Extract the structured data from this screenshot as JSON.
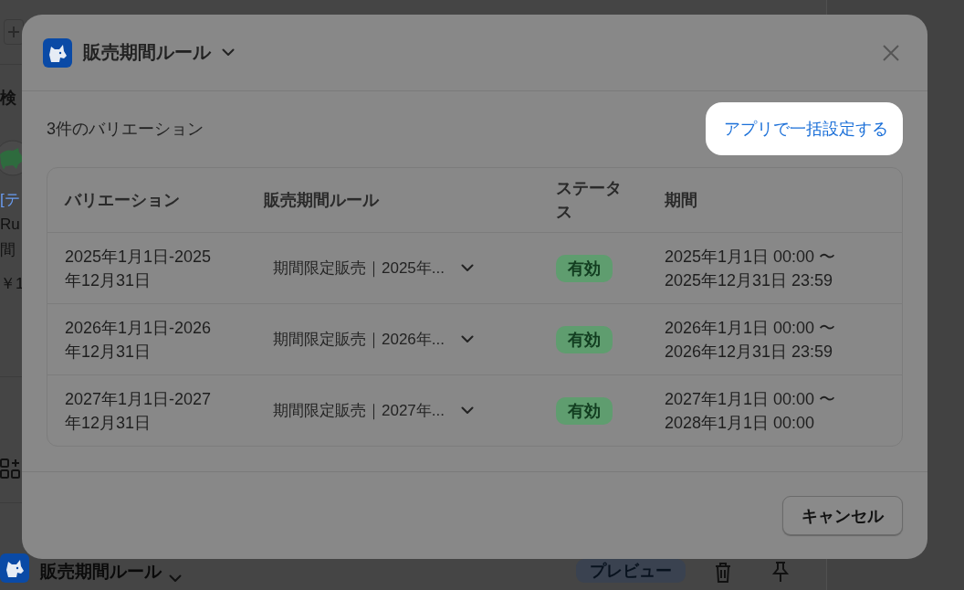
{
  "background": {
    "items": [
      {
        "kind": "heading",
        "text": "検"
      },
      {
        "kind": "link",
        "text": "[テ"
      },
      {
        "kind": "text",
        "text": "Ru"
      },
      {
        "kind": "text",
        "text": "間"
      },
      {
        "kind": "price",
        "text": "￥1"
      }
    ],
    "bottom_bar": {
      "title": "販売期間ルール",
      "badge": "プレビュー"
    }
  },
  "modal": {
    "title": "販売期間ルール",
    "count": "3件のバリエーション",
    "bulk_button": {
      "label": "アプリで一括設定する",
      "highlighted": true
    },
    "table": {
      "columns": [
        "バリエーション",
        "販売期間ルール",
        "ステータス",
        "期間"
      ],
      "rows": [
        {
          "variation": "2025年1月1日-2025年12月31日",
          "rule": "期間限定販売｜2025年...",
          "status": "有効",
          "period": "2025年1月1日 00:00 〜 2025年12月31日 23:59"
        },
        {
          "variation": "2026年1月1日-2026年12月31日",
          "rule": "期間限定販売｜2026年...",
          "status": "有効",
          "period": "2026年1月1日 00:00 〜 2026年12月31日 23:59"
        },
        {
          "variation": "2027年1月1日-2027年12月31日",
          "rule": "期間限定販売｜2027年...",
          "status": "有効",
          "period": "2027年1月1日 00:00 〜 2028年1月1日 00:00"
        }
      ]
    },
    "cancel_button": "キャンセル"
  }
}
